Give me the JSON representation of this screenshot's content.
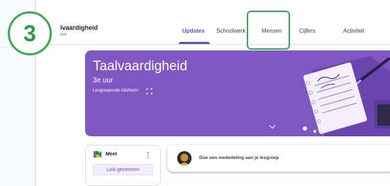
{
  "step_number": "3",
  "header": {
    "class_title": "lvaardigheid",
    "class_subtitle": "uur"
  },
  "tabs": [
    {
      "label": "Updates",
      "active": true
    },
    {
      "label": "Schoolwerk",
      "active": false
    },
    {
      "label": "Mensen",
      "active": false
    },
    {
      "label": "Cijfers",
      "active": false
    },
    {
      "label": "Activiteit",
      "active": false
    }
  ],
  "banner": {
    "title": "Taalvaardigheid",
    "subtitle": "3e uur",
    "class_code": "Lesgroepcode n3shnzm",
    "color": "#7e57c2"
  },
  "meet": {
    "label": "Meet",
    "button_label": "Link genereren"
  },
  "announce": {
    "prompt": "Doe een mededeling aan je lesgroep"
  },
  "colors": {
    "accent": "#7248b9",
    "highlight": "#34a853"
  },
  "icons": [
    "expand-icon",
    "chevron-down-icon",
    "meet-icon",
    "more-vert-icon",
    "avatar"
  ]
}
